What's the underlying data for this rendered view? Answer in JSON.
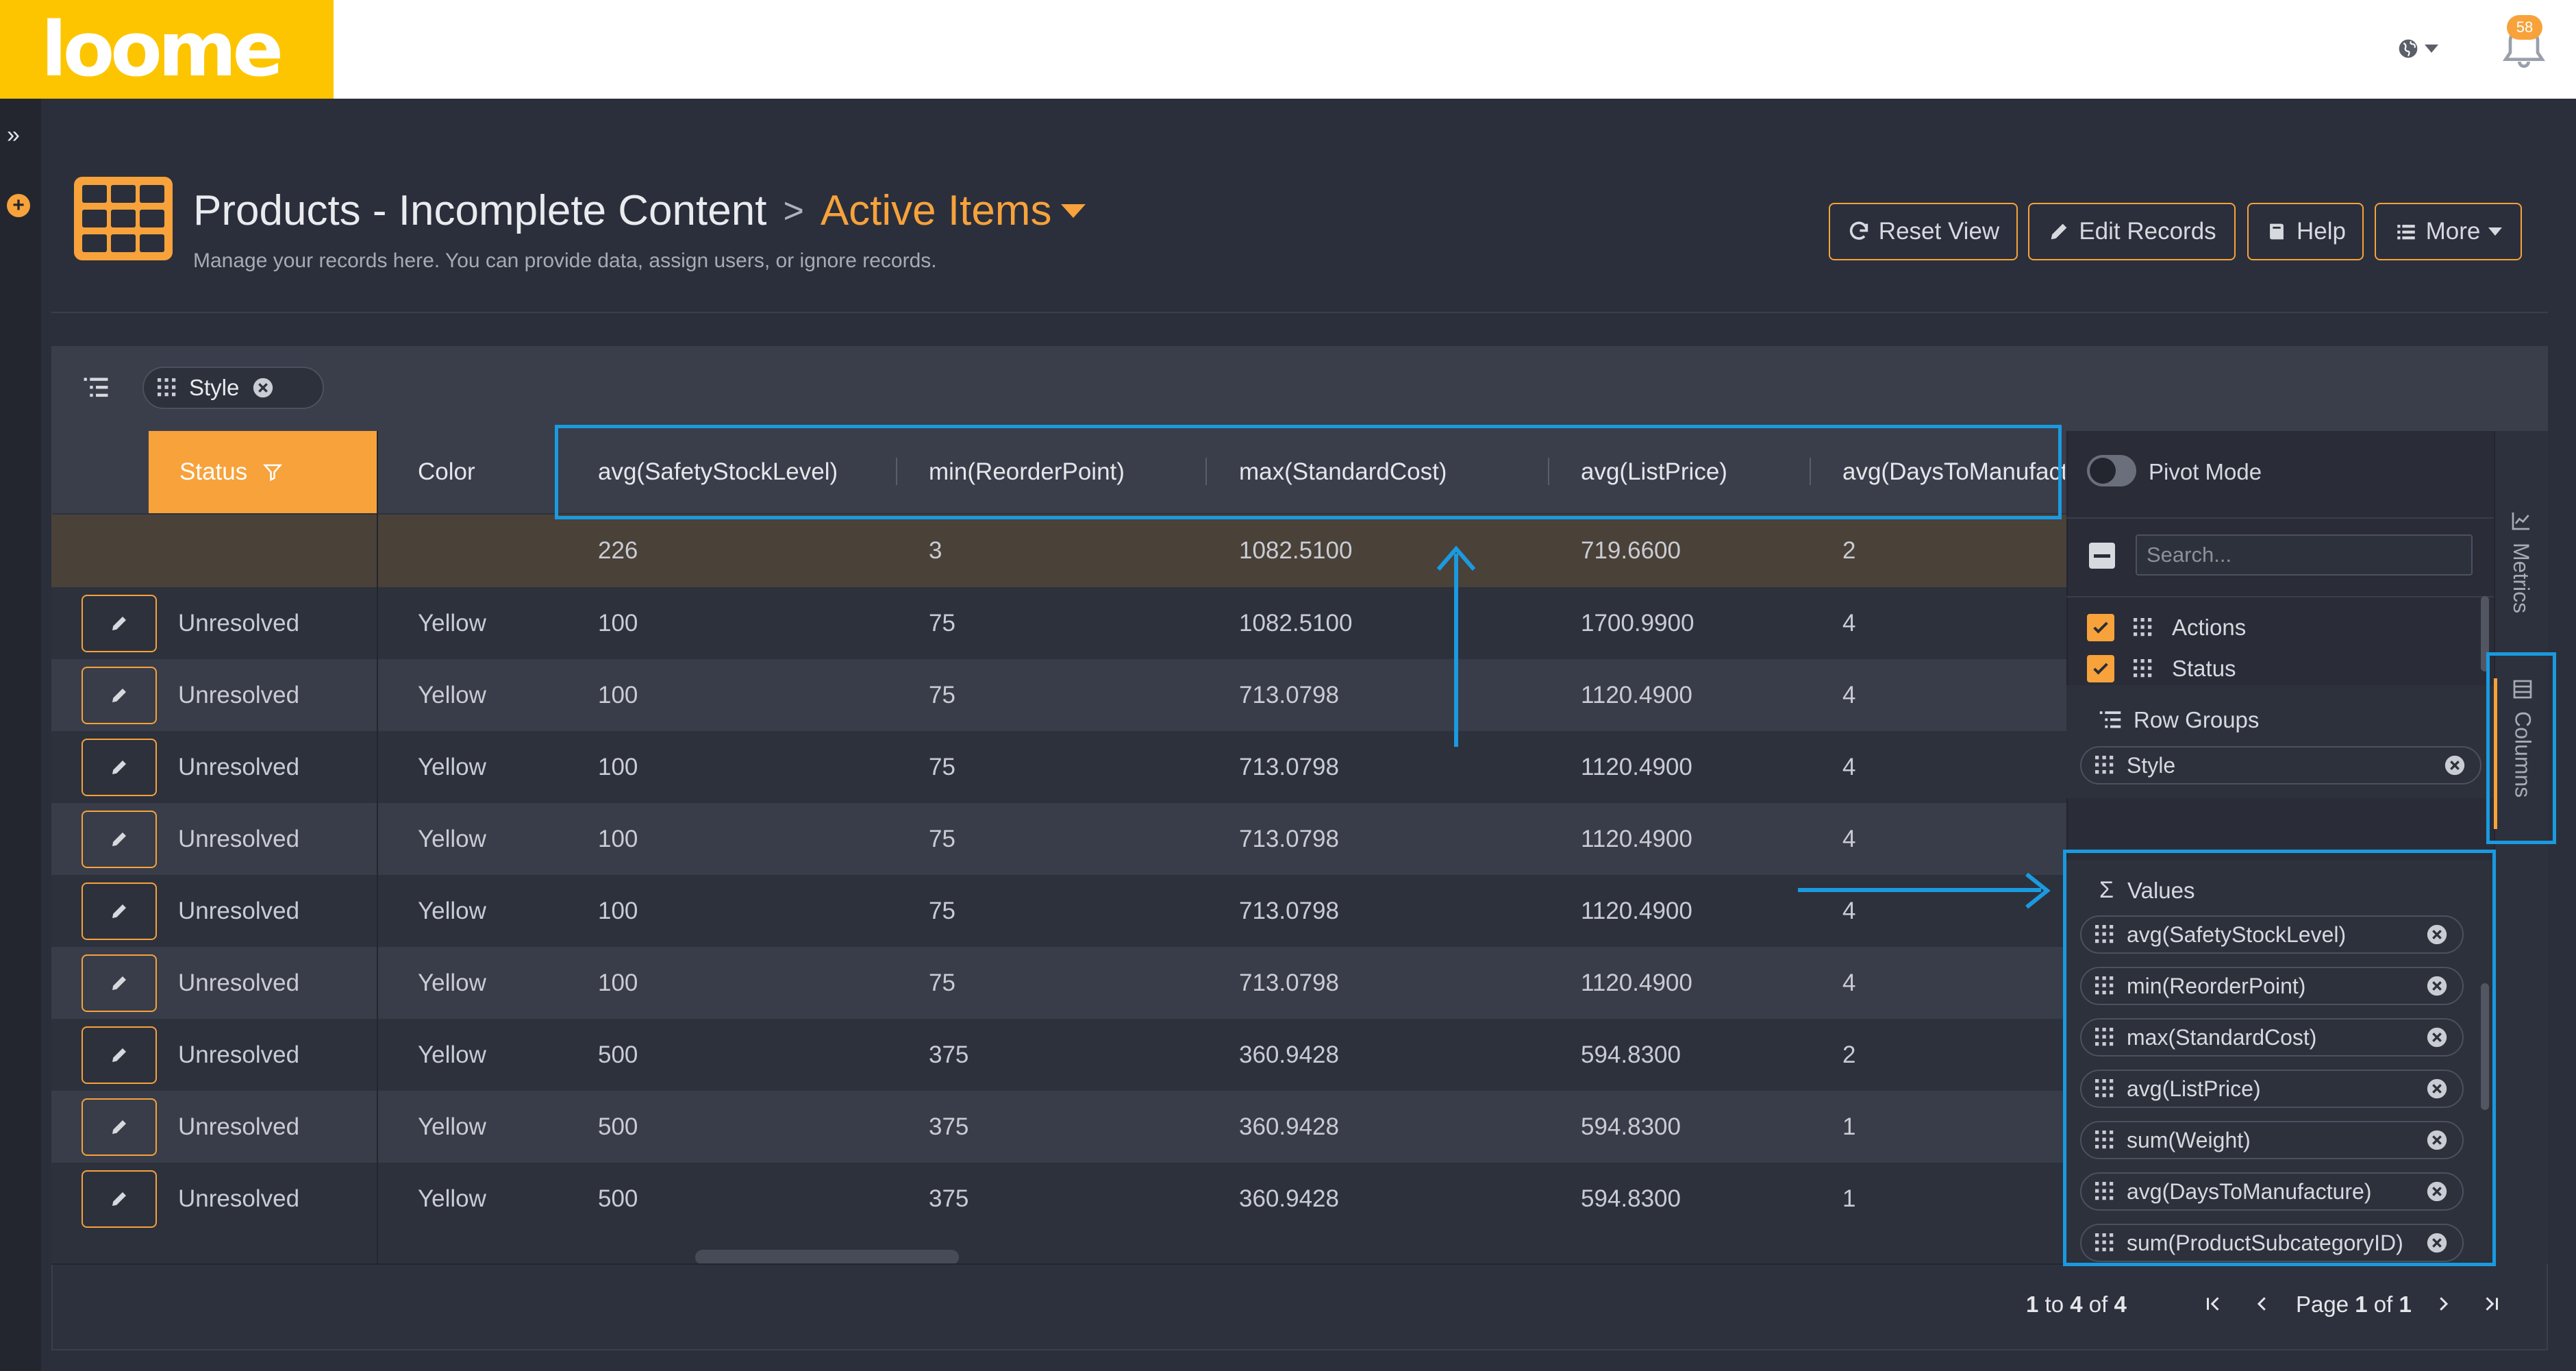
{
  "app": {
    "logo": "loome",
    "notifications_count": "58"
  },
  "header": {
    "title": "Products - Incomplete Content",
    "view_name": "Active Items",
    "subtitle": "Manage your records here. You can provide data, assign users, or ignore records.",
    "buttons": {
      "reset": "Reset View",
      "edit": "Edit Records",
      "help": "Help",
      "more": "More"
    }
  },
  "groupbar": {
    "chip": "Style"
  },
  "grid": {
    "columns": {
      "status": "Status",
      "color": "Color",
      "c1": "avg(SafetyStockLevel)",
      "c2": "min(ReorderPoint)",
      "c3": "max(StandardCost)",
      "c4": "avg(ListPrice)",
      "c5": "avg(DaysToManufacture)"
    },
    "totals": [
      "226",
      "3",
      "1082.5100",
      "719.6600",
      "2"
    ],
    "rows": [
      {
        "status": "Unresolved",
        "color": "Yellow",
        "v1": "100",
        "v2": "75",
        "v3": "1082.5100",
        "v4": "1700.9900",
        "v5": "4"
      },
      {
        "status": "Unresolved",
        "color": "Yellow",
        "v1": "100",
        "v2": "75",
        "v3": "713.0798",
        "v4": "1120.4900",
        "v5": "4"
      },
      {
        "status": "Unresolved",
        "color": "Yellow",
        "v1": "100",
        "v2": "75",
        "v3": "713.0798",
        "v4": "1120.4900",
        "v5": "4"
      },
      {
        "status": "Unresolved",
        "color": "Yellow",
        "v1": "100",
        "v2": "75",
        "v3": "713.0798",
        "v4": "1120.4900",
        "v5": "4"
      },
      {
        "status": "Unresolved",
        "color": "Yellow",
        "v1": "100",
        "v2": "75",
        "v3": "713.0798",
        "v4": "1120.4900",
        "v5": "4"
      },
      {
        "status": "Unresolved",
        "color": "Yellow",
        "v1": "100",
        "v2": "75",
        "v3": "713.0798",
        "v4": "1120.4900",
        "v5": "4"
      },
      {
        "status": "Unresolved",
        "color": "Yellow",
        "v1": "500",
        "v2": "375",
        "v3": "360.9428",
        "v4": "594.8300",
        "v5": "2"
      },
      {
        "status": "Unresolved",
        "color": "Yellow",
        "v1": "500",
        "v2": "375",
        "v3": "360.9428",
        "v4": "594.8300",
        "v5": "1"
      },
      {
        "status": "Unresolved",
        "color": "Yellow",
        "v1": "500",
        "v2": "375",
        "v3": "360.9428",
        "v4": "594.8300",
        "v5": "1"
      }
    ]
  },
  "pager": {
    "count_from": "1",
    "count_to_word": "to",
    "count_to": "4",
    "count_of_word": "of",
    "count_total": "4",
    "page_word": "Page",
    "page_current": "1",
    "page_of_word": "of",
    "page_total": "1"
  },
  "panel": {
    "pivot_mode": "Pivot Mode",
    "search_placeholder": "Search...",
    "column_list": [
      "Actions",
      "Status"
    ],
    "row_groups_label": "Row Groups",
    "row_groups": [
      "Style"
    ],
    "values_label": "Values",
    "values": [
      "avg(SafetyStockLevel)",
      "min(ReorderPoint)",
      "max(StandardCost)",
      "avg(ListPrice)",
      "sum(Weight)",
      "avg(DaysToManufacture)",
      "sum(ProductSubcategoryID)"
    ]
  },
  "side_tabs": {
    "metrics": "Metrics",
    "columns": "Columns"
  },
  "colors": {
    "accent": "#f7a23b",
    "logo_bg": "#fdc500",
    "annotation": "#1a9ae0",
    "background": "#2b2f3b"
  }
}
